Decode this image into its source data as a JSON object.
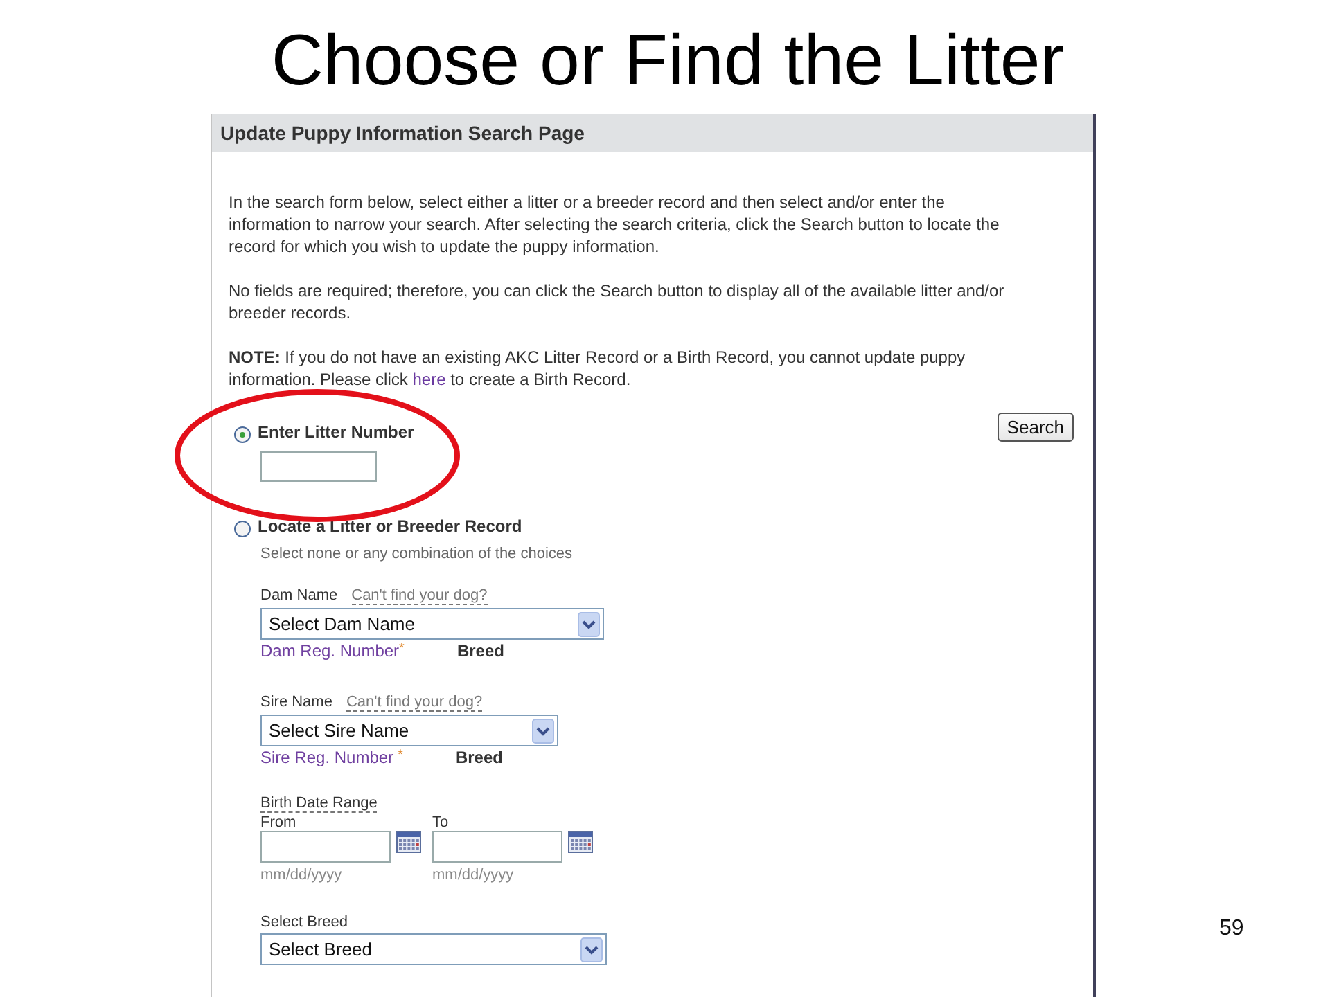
{
  "slide": {
    "title": "Choose or Find the Litter",
    "page_number": "59"
  },
  "panel": {
    "title": "Update Puppy Information Search Page",
    "paragraphs": [
      "In the search form below, select either a litter or a breeder record and then select and/or enter the information to narrow your search. After selecting the search criteria, click the Search button to locate the record for which you wish to update the puppy information.",
      "No fields are required; therefore, you can click the Search button to display all of the available litter and/or breeder records."
    ],
    "note": {
      "text": "**NOTE:** If you do not have an existing AKC Litter Record or a Birth Record, you cannot update puppy information. Please click ",
      "link": "here",
      "after": " to create a Birth Record."
    }
  },
  "options": [
    {
      "label": "Enter Litter Number",
      "selected": true
    },
    {
      "label": "Locate a Litter or Breeder Record",
      "selected": false
    }
  ],
  "search_button": "Search",
  "hint": "Select none or any combination of the choices",
  "parents": [
    {
      "label": "Dam Name",
      "help_link": "Can't find your dog?",
      "select": "Select Dam Name",
      "reg_label": "Dam Reg. Number",
      "required_mark": "*",
      "breed_label": "Breed"
    },
    {
      "label": "Sire Name",
      "help_link": "Can't find your dog?",
      "select": "Select Sire Name",
      "reg_label": "Sire Reg. Number",
      "required_mark": "*",
      "breed_label": "Breed"
    }
  ],
  "birth_date": {
    "label": "Birth Date Range",
    "ranges": [
      {
        "label": "From",
        "hint": "mm/dd/yyyy"
      },
      {
        "label": "To",
        "hint": "mm/dd/yyyy"
      }
    ]
  },
  "breed": {
    "label": "Select Breed",
    "select": "Select Breed"
  }
}
